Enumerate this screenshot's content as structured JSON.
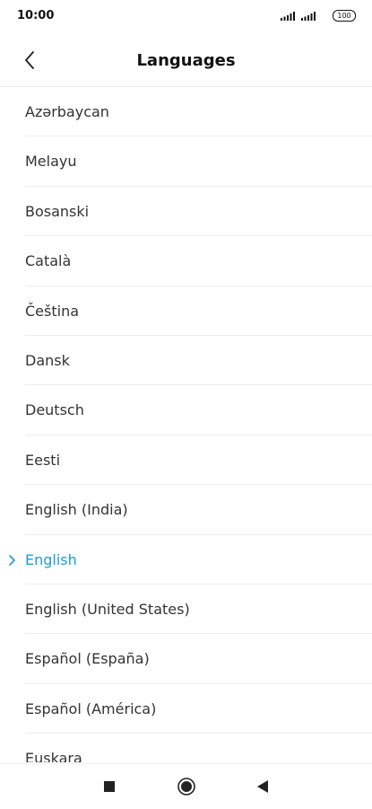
{
  "status_bar": {
    "time": "10:00",
    "battery": "100"
  },
  "header": {
    "title": "Languages"
  },
  "languages": [
    {
      "label": "Azərbaycan",
      "selected": false
    },
    {
      "label": "Melayu",
      "selected": false
    },
    {
      "label": "Bosanski",
      "selected": false
    },
    {
      "label": "Català",
      "selected": false
    },
    {
      "label": "Čeština",
      "selected": false
    },
    {
      "label": "Dansk",
      "selected": false
    },
    {
      "label": "Deutsch",
      "selected": false
    },
    {
      "label": "Eesti",
      "selected": false
    },
    {
      "label": "English (India)",
      "selected": false
    },
    {
      "label": "English",
      "selected": true
    },
    {
      "label": "English (United States)",
      "selected": false
    },
    {
      "label": "Español (España)",
      "selected": false
    },
    {
      "label": "Español (América)",
      "selected": false
    },
    {
      "label": "Euskara",
      "selected": false
    }
  ],
  "colors": {
    "accent": "#1a9cd8",
    "text": "#333333",
    "divider": "#ececec"
  },
  "icons": {
    "back": "chevron-left-icon",
    "selected": "chevron-right-icon",
    "recents": "square-icon",
    "home": "circle-icon",
    "nav_back": "triangle-left-icon"
  }
}
